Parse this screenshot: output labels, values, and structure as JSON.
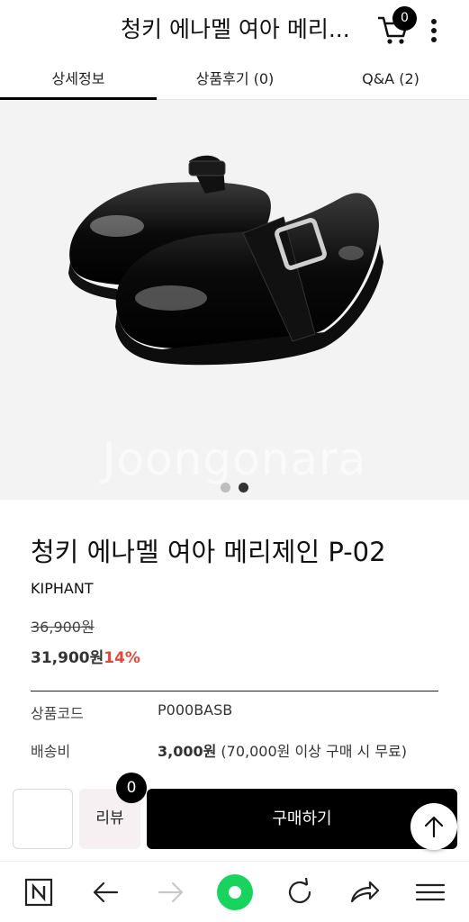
{
  "header": {
    "title": "청키 에나멜 여아 메리...",
    "cart_count": "0",
    "cart_icon": "cart-icon",
    "more_icon": "more-vertical-icon"
  },
  "tabs": [
    {
      "label": "상세정보",
      "active": true
    },
    {
      "label": "상품후기 (0)",
      "active": false
    },
    {
      "label": "Q&A (2)",
      "active": false
    }
  ],
  "gallery": {
    "watermark": "Joongonara",
    "slide_count": 2,
    "active_slide": 2
  },
  "product": {
    "name": "청키 에나멜 여아 메리제인 P-02",
    "brand": "KIPHANT",
    "original_price": "36,900원",
    "sale_price": "31,900원",
    "discount": "14%",
    "info_rows": [
      {
        "label": "상품코드",
        "value": "P000BASB"
      },
      {
        "label": "배송비",
        "value_bold": "3,000원",
        "value_rest": " (70,000원 이상 구매 시 무료)"
      }
    ]
  },
  "buy_bar": {
    "review_label": "리뷰",
    "review_count": "0",
    "buy_label": "구매하기"
  },
  "colors": {
    "accent_discount": "#e0493c",
    "buy_button": "#000000",
    "browser_green": "#18d35e"
  }
}
